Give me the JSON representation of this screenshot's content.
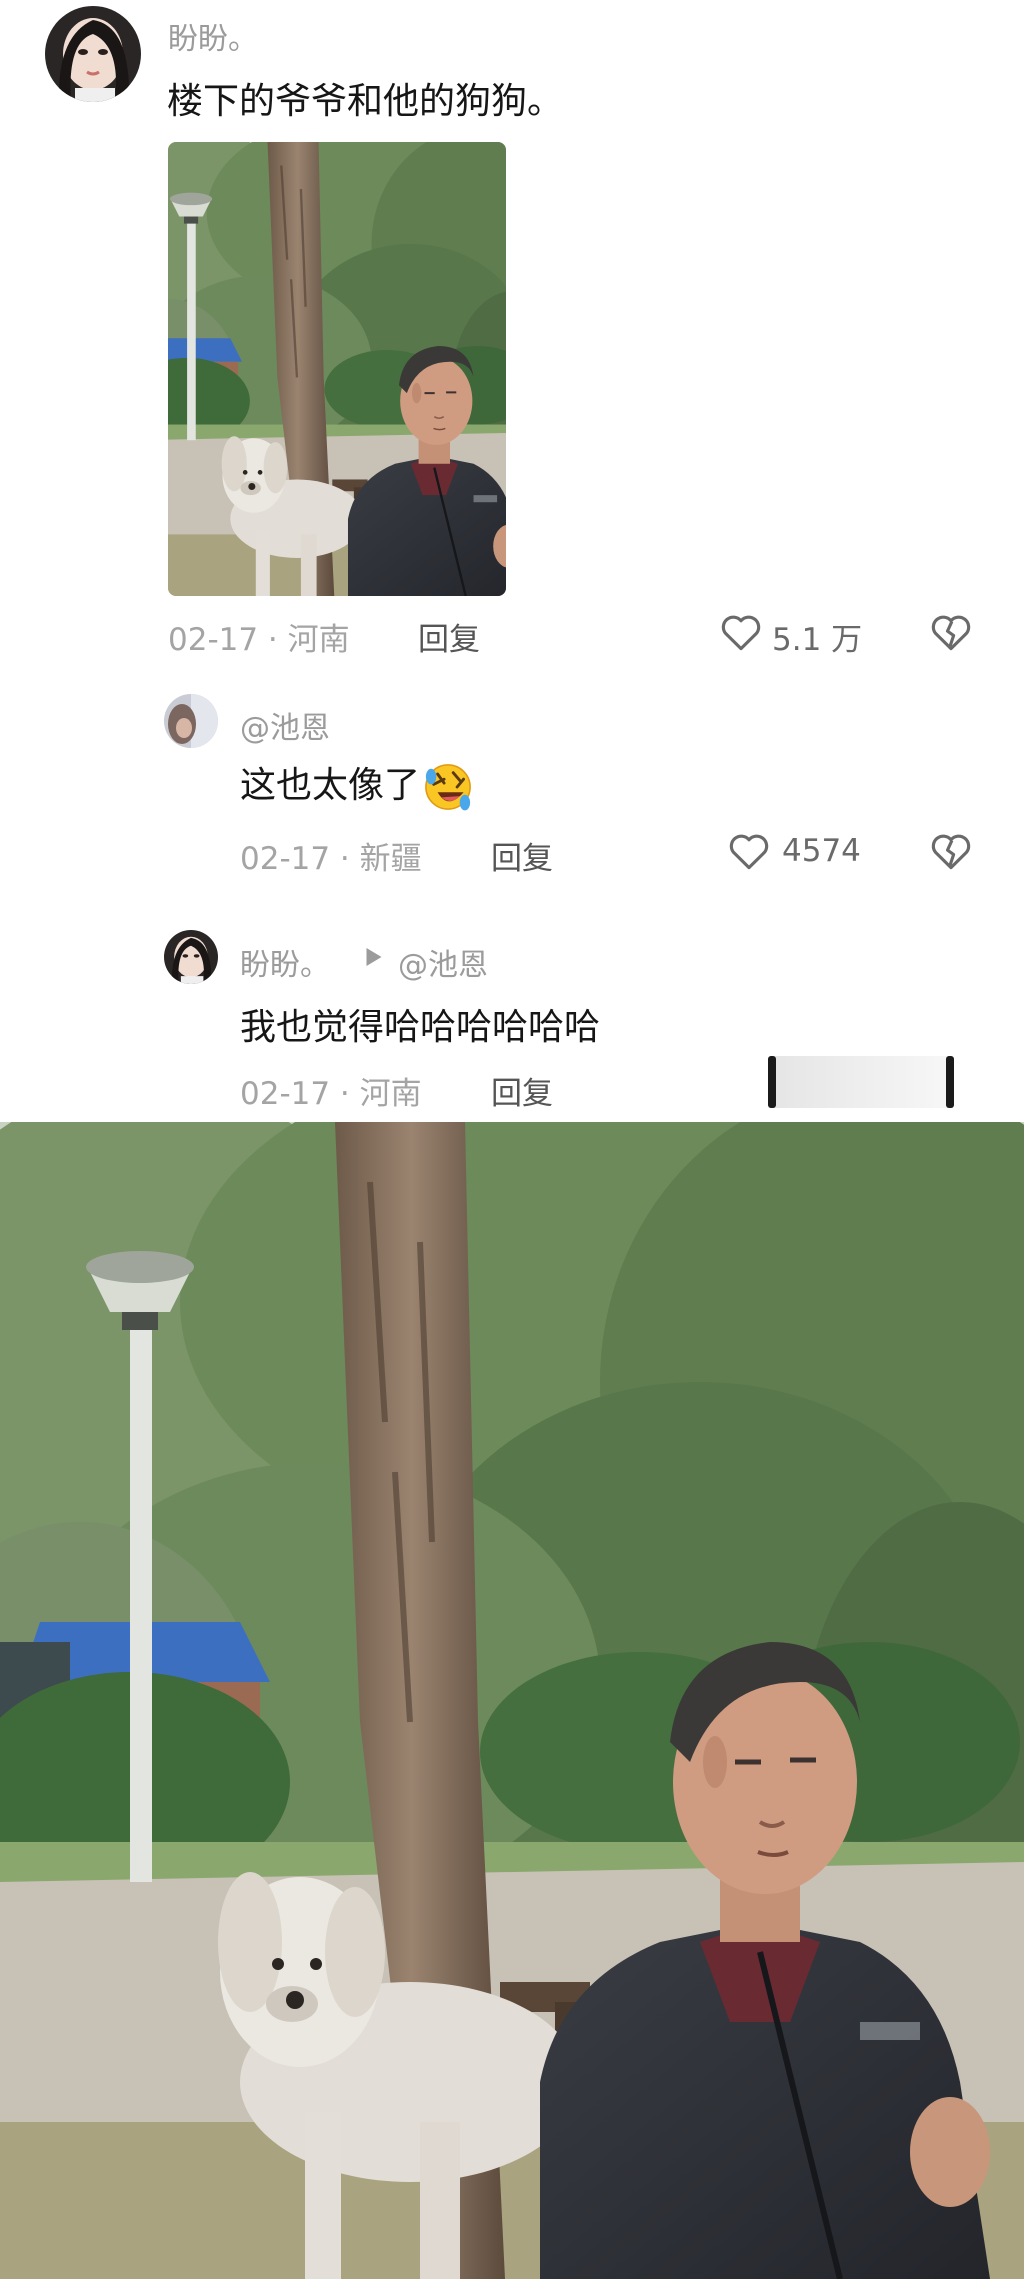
{
  "comments": [
    {
      "username": "盼盼。",
      "text": "楼下的爷爷和他的狗狗。",
      "date_location": "02-17 · 河南",
      "reply_label": "回复",
      "likes": "5.1 万"
    },
    {
      "username": "@池恩",
      "text": "这也太像了",
      "emoji": "rolling-on-floor-laughing",
      "date_location": "02-17 · 新疆",
      "reply_label": "回复",
      "likes": "4574"
    },
    {
      "username": "盼盼。",
      "reply_to": "@池恩",
      "text": "我也觉得哈哈哈哈哈哈",
      "date_location": "02-17 · 河南",
      "reply_label": "回复"
    }
  ],
  "colors": {
    "background": "#ffffff",
    "primary_text": "#161616",
    "secondary_text": "#9b9b9b",
    "icon": "#6a6a6a"
  },
  "icons": [
    "heart-outline-icon",
    "broken-heart-icon",
    "play-triangle-icon",
    "rolling-on-floor-laughing-emoji"
  ]
}
